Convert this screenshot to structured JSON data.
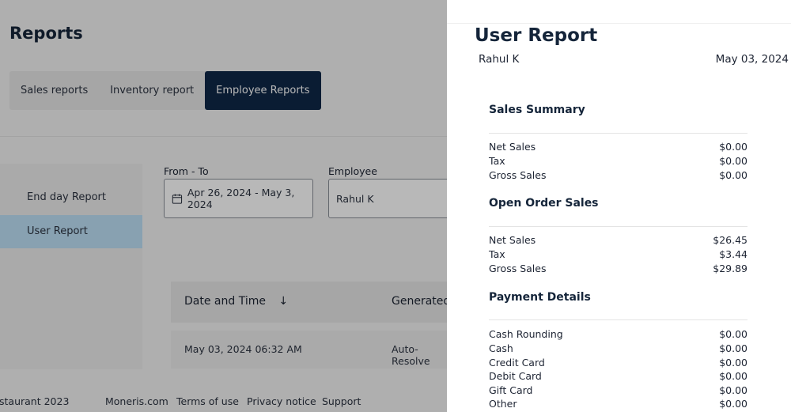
{
  "page": {
    "title": "Reports"
  },
  "tabs": [
    {
      "label": "Sales reports"
    },
    {
      "label": "Inventory report"
    },
    {
      "label": "Employee Reports"
    }
  ],
  "sidebar": {
    "items": [
      {
        "label": "End day Report"
      },
      {
        "label": "User Report"
      }
    ]
  },
  "filters": {
    "date_label": "From - To",
    "date_value": "Apr 26, 2024 - May 3, 2024",
    "employee_label": "Employee",
    "employee_value": "Rahul K"
  },
  "table": {
    "headers": [
      "Date and Time",
      "Generated"
    ],
    "sort_icon": "↓",
    "rows": [
      [
        "May 03, 2024 06:32 AM",
        "Auto-Resolve"
      ]
    ]
  },
  "footer": {
    "copyright": "staurant 2023",
    "links": [
      "Moneris.com",
      "Terms of use",
      "Privacy notice",
      "Support"
    ]
  },
  "report": {
    "title": "User Report",
    "employee": "Rahul K",
    "date": "May 03, 2024",
    "sales_summary": {
      "title": "Sales Summary",
      "rows": [
        {
          "label": "Net Sales",
          "value": "$0.00"
        },
        {
          "label": "Tax",
          "value": "$0.00"
        },
        {
          "label": "Gross Sales",
          "value": "$0.00"
        }
      ]
    },
    "open_order_sales": {
      "title": "Open Order Sales",
      "rows": [
        {
          "label": "Net Sales",
          "value": "$26.45"
        },
        {
          "label": "Tax",
          "value": "$3.44"
        },
        {
          "label": "Gross Sales",
          "value": "$29.89"
        }
      ]
    },
    "payment_details": {
      "title": "Payment Details",
      "rows": [
        {
          "label": "Cash Rounding",
          "value": "$0.00"
        },
        {
          "label": "Cash",
          "value": "$0.00"
        },
        {
          "label": "Credit Card",
          "value": "$0.00"
        },
        {
          "label": "Debit Card",
          "value": "$0.00"
        },
        {
          "label": "Gift Card",
          "value": "$0.00"
        },
        {
          "label": "Other",
          "value": "$0.00"
        }
      ]
    }
  }
}
